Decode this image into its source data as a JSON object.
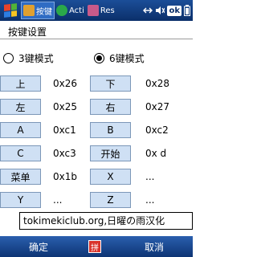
{
  "taskbar": {
    "tasks": [
      {
        "label": "按键",
        "icon": "app-icon"
      },
      {
        "label": "Acti",
        "icon": "activesync-icon"
      },
      {
        "label": "Res",
        "icon": "resource-icon"
      }
    ],
    "ok_label": "ok"
  },
  "page_title": "按键设置",
  "modes": {
    "mode3_label": "3键模式",
    "mode6_label": "6键模式",
    "selected": "6键模式"
  },
  "keys": [
    {
      "label": "上",
      "value": "0x26"
    },
    {
      "label": "下",
      "value": "0x28"
    },
    {
      "label": "左",
      "value": "0x25"
    },
    {
      "label": "右",
      "value": "0x27"
    },
    {
      "label": "A",
      "value": "0xc1"
    },
    {
      "label": "B",
      "value": "0xc2"
    },
    {
      "label": "C",
      "value": "0xc3"
    },
    {
      "label": "开始",
      "value": "0x d"
    },
    {
      "label": "菜单",
      "value": "0x1b"
    },
    {
      "label": "X",
      "value": "..."
    },
    {
      "label": "Y",
      "value": "..."
    },
    {
      "label": "Z",
      "value": "..."
    }
  ],
  "textbox_value": "tokimekiclub.org,日曜の雨汉化",
  "menubar": {
    "left_label": "确定",
    "ime_label": "拼",
    "right_label": "取消"
  },
  "colors": {
    "taskbar": "#1b4e98",
    "key_button": "#cfe0f4"
  }
}
